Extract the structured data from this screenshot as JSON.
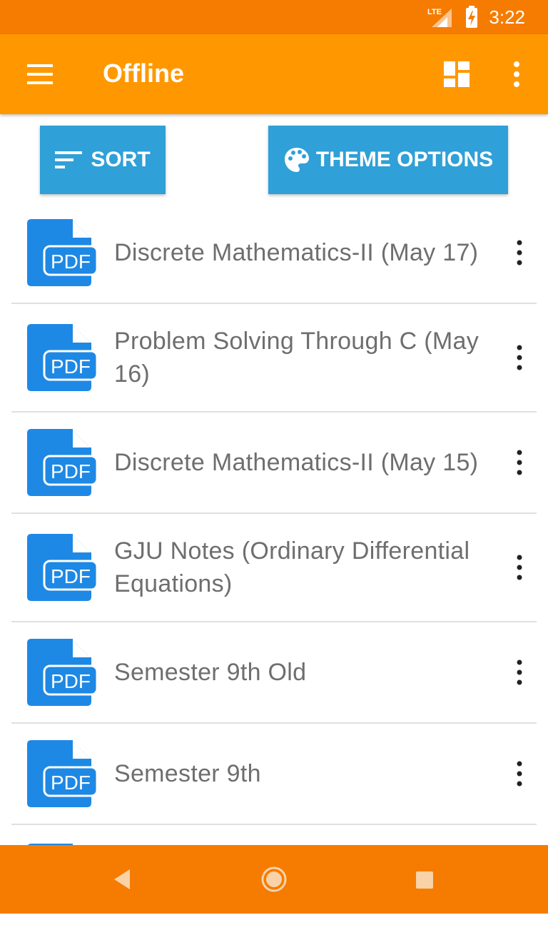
{
  "status_bar": {
    "network": "LTE",
    "time": "3:22"
  },
  "app_bar": {
    "title": "Offline"
  },
  "actions": {
    "sort_label": "SORT",
    "theme_label": "THEME OPTIONS"
  },
  "items": [
    {
      "label": "Discrete Mathematics-II (May 17)"
    },
    {
      "label": "Problem Solving Through C (May 16)"
    },
    {
      "label": "Discrete Mathematics-II (May 15)"
    },
    {
      "label": "GJU Notes (Ordinary Differential Equations)"
    },
    {
      "label": "Semester 9th Old"
    },
    {
      "label": "Semester 9th"
    }
  ],
  "pdf_icon_text": "PDF",
  "colors": {
    "status_bar": "#F57C00",
    "app_bar": "#FF9800",
    "button": "#2FA0D8",
    "pdf_icon": "#1E88E5",
    "nav_bar": "#F57C00"
  }
}
